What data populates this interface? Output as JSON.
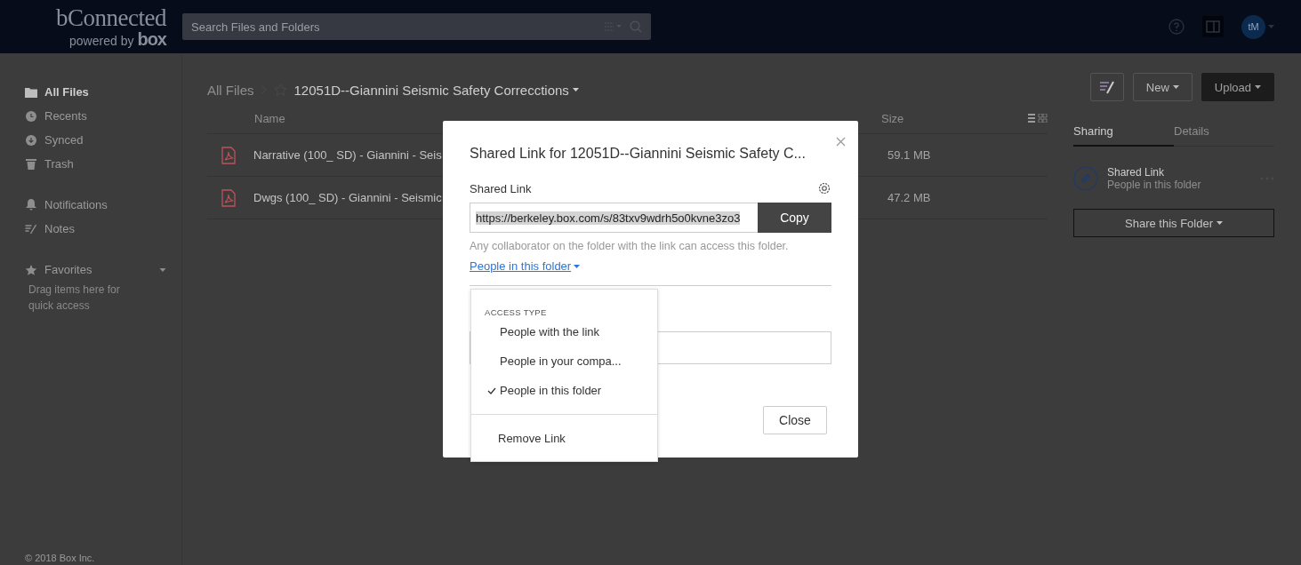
{
  "header": {
    "logo_title": "bConnected",
    "logo_sub": "powered by",
    "logo_brand": "box",
    "search": {
      "placeholder": "Search Files and Folders"
    },
    "avatar": "tM"
  },
  "sidebar": {
    "items": [
      {
        "label": "All Files",
        "selected": true
      },
      {
        "label": "Recents",
        "selected": false
      },
      {
        "label": "Synced",
        "selected": false
      },
      {
        "label": "Trash",
        "selected": false
      },
      {
        "label": "Notifications",
        "selected": false
      },
      {
        "label": "Notes",
        "selected": false
      },
      {
        "label": "Favorites",
        "selected": false
      }
    ],
    "favorites_hint": "Drag items here for quick access",
    "copyright": "© 2018 Box Inc."
  },
  "breadcrumb": {
    "root": "All Files",
    "folder": "12051D--Giannini Seismic Safety Correcctions"
  },
  "table": {
    "columns": [
      "Name",
      "Size"
    ],
    "rows": [
      {
        "name": "Narrative (100_ SD) - Giannini - Seis",
        "size": "59.1 MB"
      },
      {
        "name": "Dwgs (100_ SD) - Giannini - Seismic",
        "size": "47.2 MB"
      }
    ]
  },
  "actions": {
    "new": "New",
    "upload": "Upload"
  },
  "panel": {
    "tabs": [
      {
        "label": "Sharing",
        "selected": true
      },
      {
        "label": "Details",
        "selected": false
      }
    ],
    "shared_link": {
      "title": "Shared Link",
      "subtitle": "People in this folder"
    },
    "share_button": "Share this Folder"
  },
  "modal": {
    "title": "Shared Link for 12051D--Giannini Seismic Safety C...",
    "section_label": "Shared Link",
    "url": "https://berkeley.box.com/s/83txv9wdrh5o0kvne3zo3",
    "copy": "Copy",
    "help": "Any collaborator on the folder with the link can access this folder.",
    "access_link": "People in this folder",
    "close": "Close"
  },
  "menu": {
    "heading": "ACCESS TYPE",
    "items": [
      {
        "label": "People with the link",
        "selected": false
      },
      {
        "label": "People in your compa...",
        "selected": false
      },
      {
        "label": "People in this folder",
        "selected": true
      }
    ],
    "remove": "Remove Link"
  }
}
